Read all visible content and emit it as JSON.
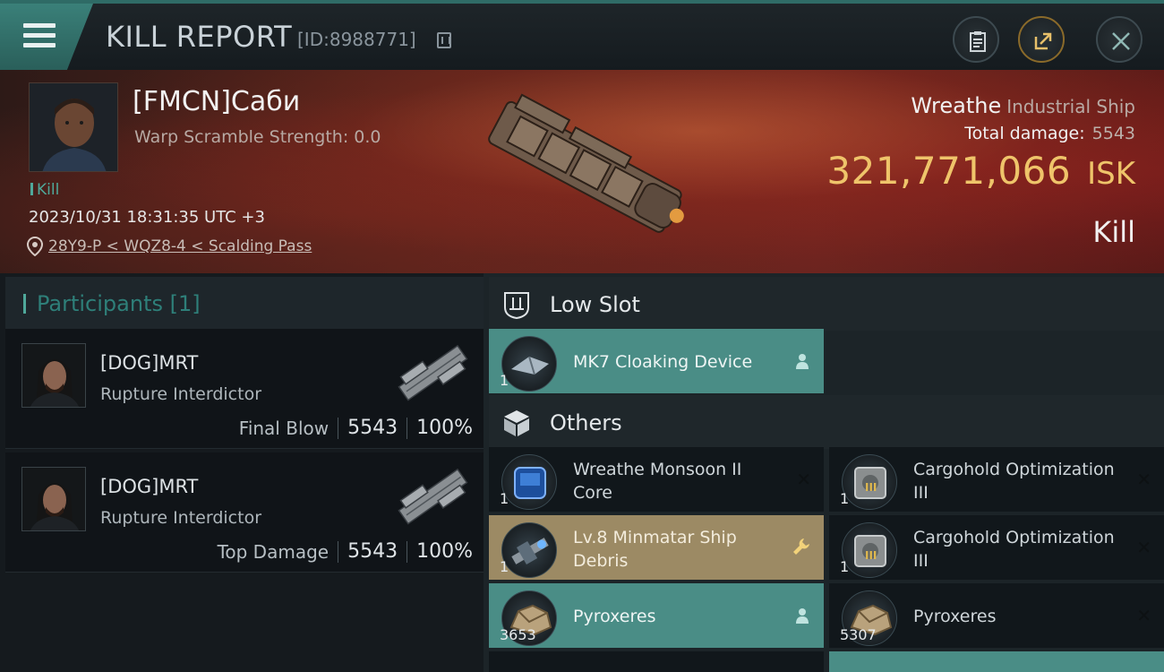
{
  "header": {
    "title": "KILL REPORT",
    "report_id": "[ID:8988771]"
  },
  "victim": {
    "name": "[FMCN]Саби",
    "warp_scramble": "Warp Scramble Strength: 0.0",
    "tag": "Kill",
    "datetime": "2023/10/31 18:31:35 UTC +3",
    "location": "28Y9-P < WQZ8-4 < Scalding Pass",
    "ship_name": "Wreathe",
    "ship_class": "Industrial Ship",
    "total_damage_label": "Total damage:",
    "total_damage": "5543",
    "isk_value": "321,771,066",
    "isk_unit": "ISK",
    "result": "Kill"
  },
  "participants": {
    "title": "Participants [1]",
    "cards": [
      {
        "name": "[DOG]MRT",
        "ship": "Rupture Interdictor",
        "role": "Final Blow",
        "damage": "5543",
        "percent": "100%"
      },
      {
        "name": "[DOG]MRT",
        "ship": "Rupture Interdictor",
        "role": "Top Damage",
        "damage": "5543",
        "percent": "100%"
      }
    ]
  },
  "sections": {
    "low_slot": "Low Slot",
    "others": "Others"
  },
  "items": {
    "cloak": {
      "qty": "1",
      "name": "MK7 Cloaking Device"
    },
    "core": {
      "qty": "1",
      "name": "Wreathe Monsoon II Core"
    },
    "cargo1": {
      "qty": "1",
      "name": "Cargohold Optimization III"
    },
    "debris": {
      "qty": "1",
      "name": "Lv.8 Minmatar Ship Debris"
    },
    "cargo2": {
      "qty": "1",
      "name": "Cargohold Optimization III"
    },
    "pyro1": {
      "qty": "3653",
      "name": "Pyroxeres"
    },
    "pyro2": {
      "qty": "5307",
      "name": "Pyroxeres"
    }
  },
  "colors": {
    "accent_teal": "#4a8d86",
    "isk_gold": "#efc46a",
    "debris_gold": "#9c8a64"
  }
}
